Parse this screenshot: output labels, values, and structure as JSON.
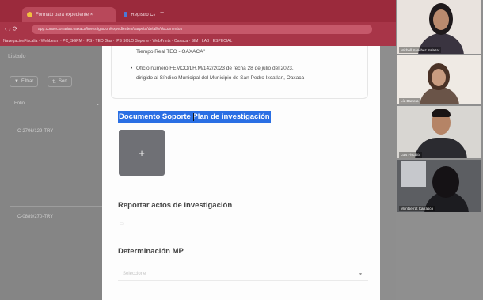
{
  "browser": {
    "tabs": [
      {
        "label": "Formato para expediente ×",
        "active": true
      },
      {
        "label": "Registro Casos, TEO, Oaxaca ×",
        "active": false
      }
    ],
    "newtab": "+",
    "url": "app.consecionarias.oaxaca/investigacion/expedientes/carpeta/detalle/documentos",
    "bookmarks": "NavegacionFiscalia · WebLearn · PC_SGPM · IPS · TEO Gas · IPS SOLO Soporte · WebPrints · Oaxaca · SIM · LAB · ESPECIAL"
  },
  "background": {
    "top_label": "Listado",
    "filter_label": "Filtrar",
    "sort_label": "Sort",
    "folio_header": "Folio",
    "record_1": "C-2706/129-TRY",
    "record_2": "C-0889/270-TRY"
  },
  "modal": {
    "list_line_1": "Tiempo Real TEO - OAXACA\"",
    "list_line_2": "Oficio número FEMCO/LH.M/142/2023 de fecha 28 de julio del 2023,",
    "list_line_3": "dirigido al Síndico Municipal del Municipio de San Pedro Ixcatlan, Oaxaca",
    "doc_support_title": "Documento Soporte Plan de investigación",
    "upload_plus": "+",
    "report_title": "Reportar actos de investigación",
    "determination_title": "Determinación MP",
    "determination_placeholder": "Seleccione"
  },
  "participants": [
    {
      "name": "Michell Sánchez Salazar"
    },
    {
      "name": "Lía Barrera"
    },
    {
      "name": "Luis Fiscalía"
    },
    {
      "name": "Montserrat Carrasco"
    }
  ]
}
